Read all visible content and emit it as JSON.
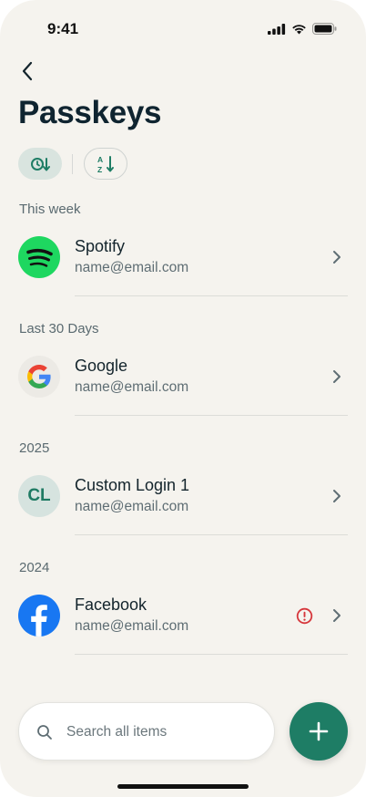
{
  "status_bar": {
    "time": "9:41"
  },
  "header": {
    "title": "Passkeys"
  },
  "sort": {
    "recent_icon": "clock-sort-icon",
    "alpha_icon": "az-sort-icon"
  },
  "sections": [
    {
      "label": "This week",
      "items": [
        {
          "name": "Spotify",
          "email": "name@email.com",
          "logo": "spotify-logo"
        }
      ]
    },
    {
      "label": "Last 30 Days",
      "items": [
        {
          "name": "Google",
          "email": "name@email.com",
          "logo": "google-logo"
        }
      ]
    },
    {
      "label": "2025",
      "items": [
        {
          "name": "Custom Login 1",
          "email": "name@email.com",
          "initials": "CL"
        }
      ]
    },
    {
      "label": "2024",
      "items": [
        {
          "name": "Facebook",
          "email": "name@email.com",
          "logo": "facebook-logo",
          "warning": true
        }
      ]
    }
  ],
  "search": {
    "placeholder": "Search all items"
  },
  "colors": {
    "accent": "#1e7d65",
    "background": "#f5f3ee",
    "warning": "#d6363b"
  }
}
